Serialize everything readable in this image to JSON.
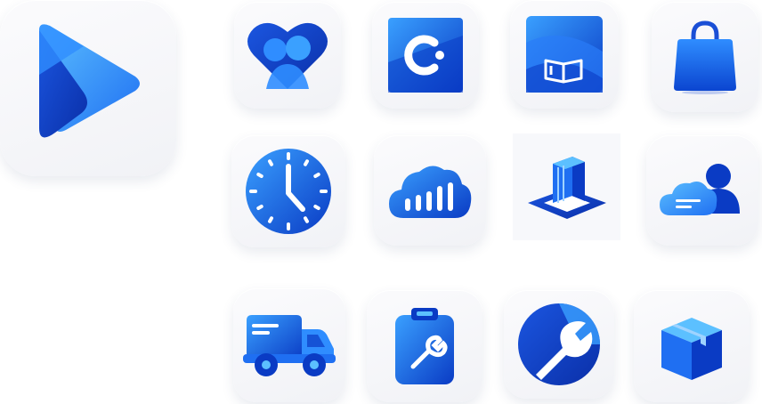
{
  "colors": {
    "accent_dark": "#0a3bc4",
    "accent": "#1565f0",
    "accent_light": "#3aa0ff",
    "tile_bg": "#f3f4f7"
  },
  "icons": [
    {
      "name": "play-logo-icon"
    },
    {
      "name": "heart-people-icon"
    },
    {
      "name": "c-logo-icon"
    },
    {
      "name": "open-book-icon"
    },
    {
      "name": "shopping-bag-icon"
    },
    {
      "name": "clock-icon"
    },
    {
      "name": "cloud-bar-chart-icon"
    },
    {
      "name": "layered-blocks-icon"
    },
    {
      "name": "cloud-user-icon"
    },
    {
      "name": "delivery-truck-icon"
    },
    {
      "name": "clipboard-wrench-icon"
    },
    {
      "name": "wrench-circle-icon"
    },
    {
      "name": "package-box-icon"
    }
  ]
}
